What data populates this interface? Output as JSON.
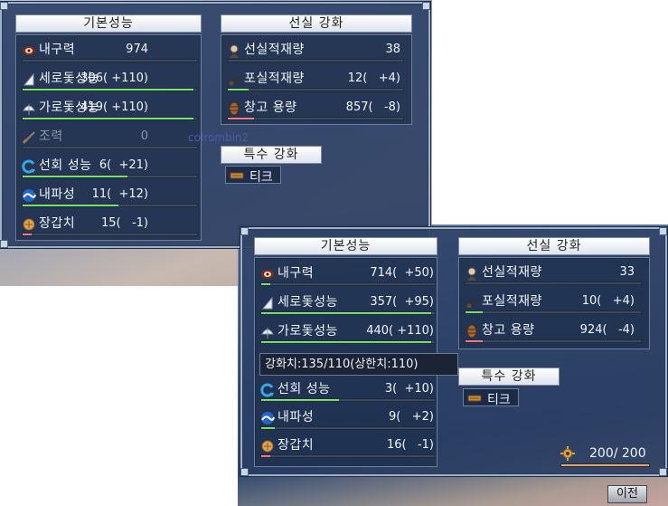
{
  "screen1": {
    "basic_header": "기본성능",
    "cabin_header": "선실 강화",
    "special_header": "특수 강화",
    "stats": [
      {
        "icon": "hull-icon",
        "label": "내구력",
        "value": "974",
        "bar": 0.0,
        "color": "g"
      },
      {
        "icon": "fore-aft-sail-icon",
        "label": "세로돛성능",
        "value": "306( +110)",
        "bar": 0.98,
        "color": "g"
      },
      {
        "icon": "square-sail-icon",
        "label": "가로돛성능",
        "value": "419( +110)",
        "bar": 0.98,
        "color": "g"
      },
      {
        "icon": "oar-icon",
        "label": "조력",
        "value": "0",
        "bar": 0.0,
        "color": "g",
        "dim": true
      },
      {
        "icon": "turning-icon",
        "label": "선회 성능",
        "value": "6(  +21)",
        "bar": 0.6,
        "color": "g"
      },
      {
        "icon": "wave-resistance-icon",
        "label": "내파성",
        "value": "11(  +12)",
        "bar": 0.55,
        "color": "g"
      },
      {
        "icon": "armor-icon",
        "label": "장갑치",
        "value": "15(   -1)",
        "bar": 0.05,
        "color": "r"
      }
    ],
    "cabin": [
      {
        "icon": "crew-icon",
        "label": "선실적재량",
        "value": "38",
        "bar": 0.0,
        "color": "g"
      },
      {
        "icon": "cannon-icon",
        "label": "포실적재량",
        "value": "12(   +4)",
        "bar": 0.12,
        "color": "g"
      },
      {
        "icon": "cargo-icon",
        "label": "창고 용량",
        "value": "857(   -8)",
        "bar": 0.15,
        "color": "r"
      }
    ],
    "special_item": "티크",
    "overlay_name": "colrombin2"
  },
  "screen2": {
    "basic_header": "기본성능",
    "cabin_header": "선실 강화",
    "special_header": "특수 강화",
    "stats": [
      {
        "icon": "hull-icon",
        "label": "내구력",
        "value": "714(  +50)",
        "bar": 0.05,
        "color": "g"
      },
      {
        "icon": "fore-aft-sail-icon",
        "label": "세로돛성능",
        "value": "357(  +95)",
        "bar": 0.98,
        "color": "g"
      },
      {
        "icon": "square-sail-icon",
        "label": "가로돛성능",
        "value": "440( +110)",
        "bar": 0.98,
        "color": "g"
      },
      {
        "icon": "turning-icon",
        "label": "선회 성능",
        "value": "3(  +10)",
        "bar": 0.45,
        "color": "g"
      },
      {
        "icon": "wave-resistance-icon",
        "label": "내파성",
        "value": "9(   +2)",
        "bar": 0.08,
        "color": "g"
      },
      {
        "icon": "armor-icon",
        "label": "장갑치",
        "value": "16(   -1)",
        "bar": 0.05,
        "color": "r"
      }
    ],
    "cabin": [
      {
        "icon": "crew-icon",
        "label": "선실적재량",
        "value": "33",
        "bar": 0.0,
        "color": "g"
      },
      {
        "icon": "cannon-icon",
        "label": "포실적재량",
        "value": "10(   +4)",
        "bar": 0.1,
        "color": "g"
      },
      {
        "icon": "cargo-icon",
        "label": "창고 용량",
        "value": "924(   -4)",
        "bar": 0.1,
        "color": "r"
      }
    ],
    "special_item": "티크",
    "tooltip": "강화치:135/110(상한치:110)",
    "durability": "200/ 200",
    "durability_bar": 1.0,
    "prev_button": "이전"
  }
}
